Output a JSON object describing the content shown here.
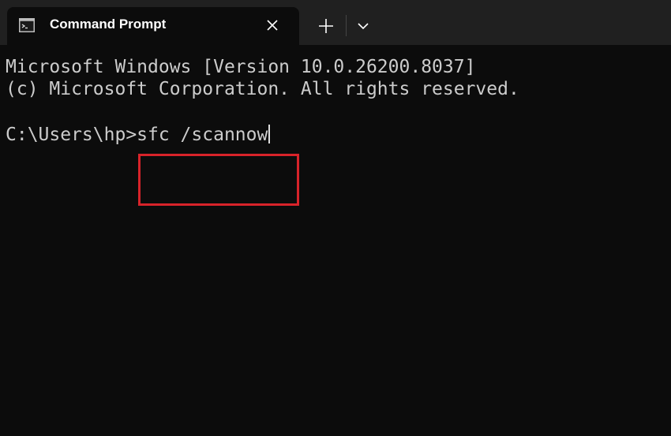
{
  "tab": {
    "title": "Command Prompt",
    "icon": "command-prompt-icon"
  },
  "titlebar": {
    "close_icon": "close-icon",
    "new_tab_icon": "plus-icon",
    "dropdown_icon": "chevron-down-icon"
  },
  "terminal": {
    "line1": "Microsoft Windows [Version 10.0.26200.8037]",
    "line2": "(c) Microsoft Corporation. All rights reserved.",
    "prompt": "C:\\Users\\hp>",
    "command": "sfc /scannow"
  },
  "colors": {
    "background": "#0c0c0c",
    "titlebar": "#202020",
    "text": "#cccccc",
    "highlight": "#d8232a"
  }
}
